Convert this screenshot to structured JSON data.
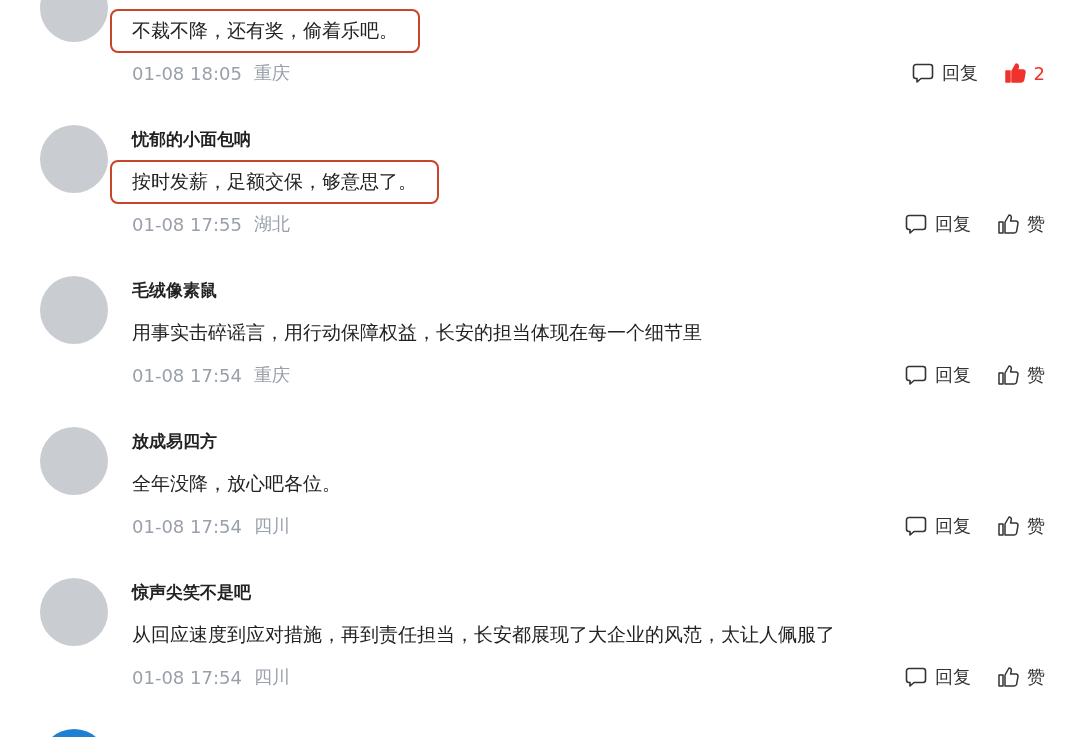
{
  "comments": [
    {
      "text": "不裁不降，还有奖，偷着乐吧。",
      "highlighted": true,
      "time": "01-08 18:05",
      "location": "重庆",
      "reply": "回复",
      "like": {
        "label": "2",
        "liked": true
      }
    },
    {
      "username": "忧郁的小面包呐",
      "text": "按时发薪，足额交保，够意思了。",
      "highlighted": true,
      "time": "01-08 17:55",
      "location": "湖北",
      "reply": "回复",
      "like": {
        "label": "赞",
        "liked": false
      }
    },
    {
      "username": "毛绒像素鼠",
      "text": "用事实击碎谣言，用行动保障权益，长安的担当体现在每一个细节里",
      "highlighted": false,
      "time": "01-08 17:54",
      "location": "重庆",
      "reply": "回复",
      "like": {
        "label": "赞",
        "liked": false
      }
    },
    {
      "username": "放成易四方",
      "text": "全年没降，放心吧各位。",
      "highlighted": false,
      "time": "01-08 17:54",
      "location": "四川",
      "reply": "回复",
      "like": {
        "label": "赞",
        "liked": false
      }
    },
    {
      "username": "惊声尖笑不是吧",
      "text": "从回应速度到应对措施，再到责任担当，长安都展现了大企业的风范，太让人佩服了",
      "highlighted": false,
      "time": "01-08 17:54",
      "location": "四川",
      "reply": "回复",
      "like": {
        "label": "赞",
        "liked": false
      }
    }
  ]
}
